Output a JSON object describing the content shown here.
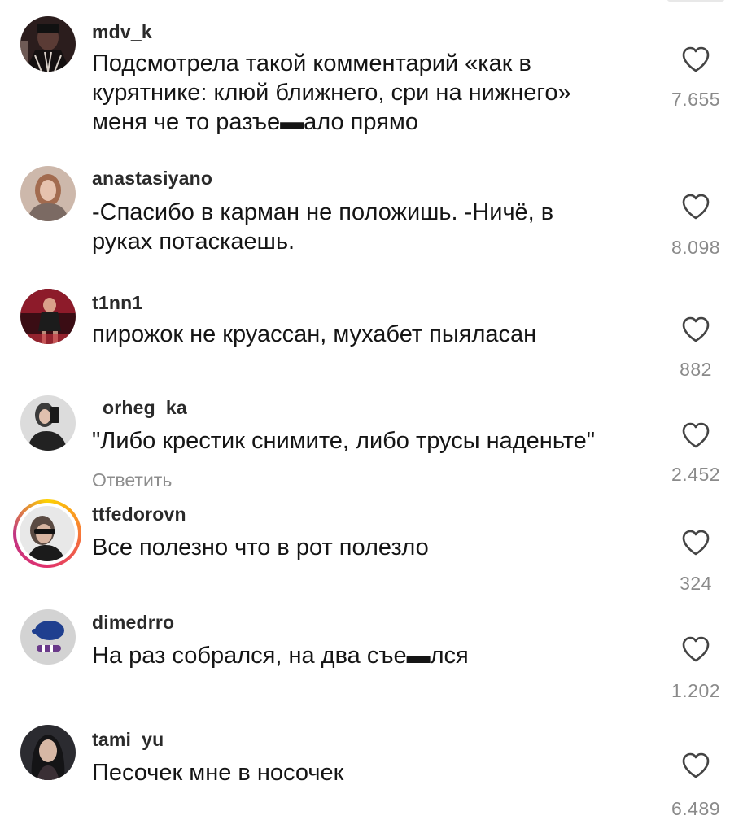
{
  "comments": [
    {
      "username": "mdv_k",
      "text": "Подсмотрела такой комментарий «как в\nкурятнике: клюй ближнего, сри на нижнего»\nменя че то разъе▬ало прямо",
      "likes": "7.655",
      "avatar_icon": "avatar-dark-costume",
      "avatar_color": "#3a2a2a"
    },
    {
      "username": "anastasiyano",
      "text": "-Спасибо в карман не положишь. -Ничё, в\nруках потаскаешь.",
      "likes": "8.098",
      "avatar_icon": "avatar-girl-blonde",
      "avatar_color": "#b78a7a"
    },
    {
      "username": "t1nn1",
      "text": "пирожок не круассан, мухабет пыяласан",
      "likes": "882",
      "avatar_icon": "avatar-girl-red-room",
      "avatar_color": "#7a1a2a"
    },
    {
      "username": "_orheg_ka",
      "text": "\"Либо крестик снимите, либо трусы наденьте\"",
      "reply_label": "Ответить",
      "likes": "2.452",
      "avatar_icon": "avatar-girl-phone-selfie",
      "avatar_color": "#d8d8d8"
    },
    {
      "username": "ttfedorovn",
      "text": "Все полезно что в рот полезло",
      "likes": "324",
      "avatar_icon": "avatar-girl-sunglasses",
      "avatar_color": "#555555",
      "has_story": true
    },
    {
      "username": "dimedrro",
      "text": "На раз собрался, на два съе▬лся",
      "likes": "1.202",
      "avatar_icon": "avatar-blue-cap-toy",
      "avatar_color": "#c9c9c9"
    },
    {
      "username": "tami_yu",
      "text": "Песочек мне в носочек",
      "likes": "6.489",
      "avatar_icon": "avatar-drawn-girl-dark",
      "avatar_color": "#2a2a2a"
    }
  ],
  "icons": {
    "like": "heart-outline-icon"
  },
  "colors": {
    "username": "#2a2a2a",
    "text": "#151515",
    "muted": "#8e8e8e",
    "heart": "#444444"
  }
}
